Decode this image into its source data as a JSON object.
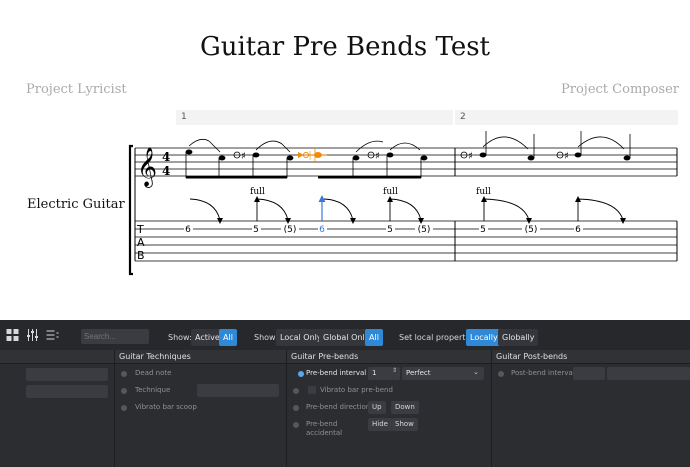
{
  "score": {
    "title": "Guitar Pre Bends Test",
    "lyricist": "Project Lyricist",
    "composer": "Project Composer",
    "instrument": "Electric Guitar",
    "measure_numbers": [
      "1",
      "2"
    ],
    "time_signature": [
      "4",
      "4"
    ],
    "tab_clef": [
      "T",
      "A",
      "B"
    ],
    "bend_labels": [
      "full",
      "full",
      "full"
    ],
    "tab_numbers": [
      "6",
      "5",
      "(5)",
      "6",
      "5",
      "(5)",
      "5",
      "(5)",
      "6"
    ]
  },
  "toolbar": {
    "search_placeholder": "Search...",
    "show_label_1": "Show:",
    "active": "Active",
    "all_1": "All",
    "show_label_2": "Show:",
    "local_only": "Local Only",
    "global_only": "Global Only",
    "all_2": "All",
    "set_local_label": "Set local properties:",
    "locally": "Locally",
    "globally": "Globally"
  },
  "panels": {
    "techniques": {
      "title": "Guitar Techniques",
      "dead_note": "Dead note",
      "technique": "Technique",
      "vibrato_scoop": "Vibrato bar scoop"
    },
    "prebends": {
      "title": "Guitar Pre-bends",
      "interval_label": "Pre-bend interval",
      "interval_value": "1",
      "interval_quality": "Perfect",
      "vibrato_prebend": "Vibrato bar pre-bend",
      "direction_label": "Pre-bend direction",
      "up": "Up",
      "down": "Down",
      "accidental_label_1": "Pre-bend",
      "accidental_label_2": "accidental",
      "hide": "Hide",
      "show": "Show"
    },
    "postbends": {
      "title": "Guitar Post-bends",
      "interval_label": "Post-bend interval"
    }
  },
  "colors": {
    "accent": "#2f89d9",
    "selection": "#f08a00",
    "tab_selected": "#3a78d8",
    "panel_bg": "#2b2d31"
  }
}
